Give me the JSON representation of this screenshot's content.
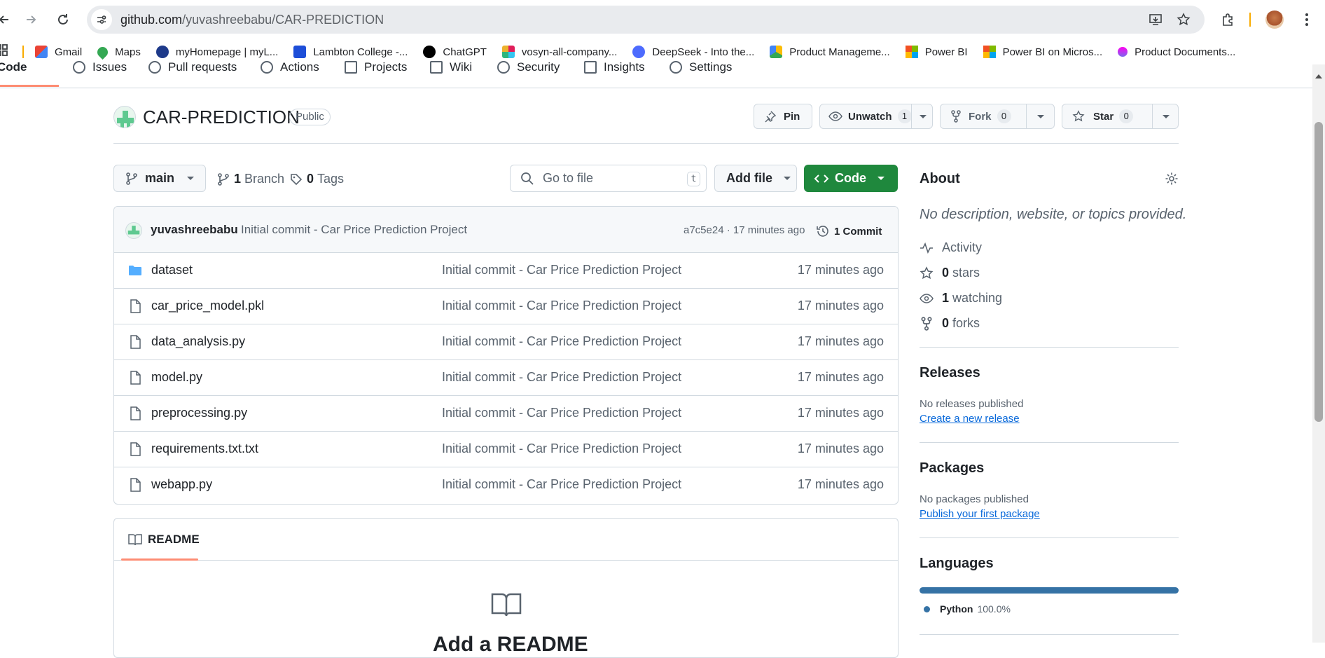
{
  "browser": {
    "url_host": "github.com",
    "url_path": "/yuvashreebabu/CAR-PREDICTION",
    "bookmarks": [
      {
        "label": "Gmail",
        "color": "#ea4335"
      },
      {
        "label": "Maps",
        "color": "#34a853"
      },
      {
        "label": "myHomepage | myL...",
        "color": "#1e3a8a"
      },
      {
        "label": "Lambton College -...",
        "color": "#1d4ed8"
      },
      {
        "label": "ChatGPT",
        "color": "#000000"
      },
      {
        "label": "vosyn-all-company...",
        "color": "#e01e5a"
      },
      {
        "label": "DeepSeek - Into the...",
        "color": "#4d6bfe"
      },
      {
        "label": "Product Manageme...",
        "color": "#fbbc04"
      },
      {
        "label": "Power BI",
        "color": "#f2c811"
      },
      {
        "label": "Power BI on Micros...",
        "color": "#f25022"
      },
      {
        "label": "Product Documents...",
        "color": "#7b68ee"
      }
    ]
  },
  "repo_nav": {
    "tabs": [
      "Code",
      "Issues",
      "Pull requests",
      "Actions",
      "Projects",
      "Wiki",
      "Security",
      "Insights",
      "Settings"
    ]
  },
  "repo": {
    "name": "CAR-PREDICTION",
    "visibility": "Public",
    "pin_label": "Pin",
    "unwatch_label": "Unwatch",
    "watch_count": "1",
    "fork_label": "Fork",
    "fork_count": "0",
    "star_label": "Star",
    "star_count": "0"
  },
  "toolbar": {
    "branch": "main",
    "branch_count": "1",
    "branch_label": "Branch",
    "tag_count": "0",
    "tag_label": "Tags",
    "goto_placeholder": "Go to file",
    "goto_kbd": "t",
    "add_file_label": "Add file",
    "code_label": "Code"
  },
  "latest_commit": {
    "author": "yuvashreebabu",
    "message": "Initial commit - Car Price Prediction Project",
    "hash_time": "a7c5e24 · 17 minutes ago",
    "commits_label": "1 Commit"
  },
  "files": [
    {
      "name": "dataset",
      "type": "folder",
      "message": "Initial commit - Car Price Prediction Project",
      "time": "17 minutes ago"
    },
    {
      "name": "car_price_model.pkl",
      "type": "file",
      "message": "Initial commit - Car Price Prediction Project",
      "time": "17 minutes ago"
    },
    {
      "name": "data_analysis.py",
      "type": "file",
      "message": "Initial commit - Car Price Prediction Project",
      "time": "17 minutes ago"
    },
    {
      "name": "model.py",
      "type": "file",
      "message": "Initial commit - Car Price Prediction Project",
      "time": "17 minutes ago"
    },
    {
      "name": "preprocessing.py",
      "type": "file",
      "message": "Initial commit - Car Price Prediction Project",
      "time": "17 minutes ago"
    },
    {
      "name": "requirements.txt.txt",
      "type": "file",
      "message": "Initial commit - Car Price Prediction Project",
      "time": "17 minutes ago"
    },
    {
      "name": "webapp.py",
      "type": "file",
      "message": "Initial commit - Car Price Prediction Project",
      "time": "17 minutes ago"
    }
  ],
  "readme": {
    "tab_label": "README",
    "add_heading": "Add a README"
  },
  "about": {
    "title": "About",
    "description": "No description, website, or topics provided.",
    "activity_label": "Activity",
    "stars_count": "0",
    "stars_label": "stars",
    "watching_count": "1",
    "watching_label": "watching",
    "forks_count": "0",
    "forks_label": "forks"
  },
  "releases": {
    "title": "Releases",
    "empty": "No releases published",
    "link": "Create a new release"
  },
  "packages": {
    "title": "Packages",
    "empty": "No packages published",
    "link": "Publish your first package"
  },
  "languages": {
    "title": "Languages",
    "items": [
      {
        "name": "Python",
        "percent": "100.0%",
        "share": 1.0,
        "color": "#3572a5"
      }
    ]
  },
  "colors": {
    "accent_green": "#1f883d",
    "link_blue": "#0969da",
    "tab_underline": "#fd8c73"
  }
}
